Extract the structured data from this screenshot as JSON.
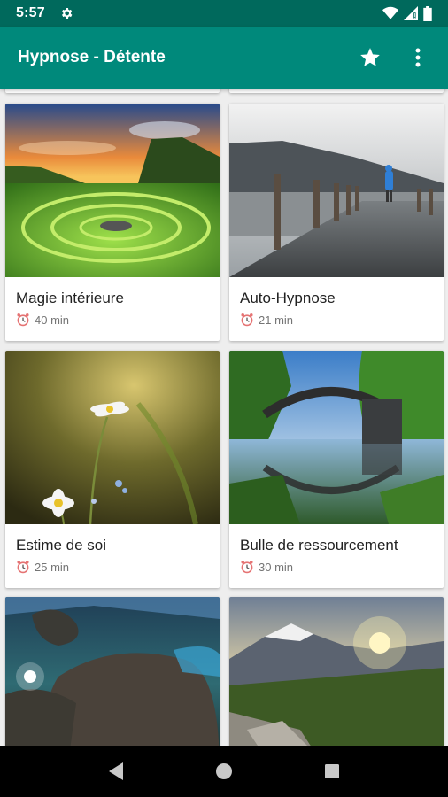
{
  "status_bar": {
    "time": "5:57",
    "icons": [
      "gear-icon",
      "wifi-icon",
      "signal-icon",
      "battery-icon"
    ]
  },
  "app_bar": {
    "title": "Hypnose - Détente",
    "actions": [
      "star-icon",
      "more-vert-icon"
    ]
  },
  "colors": {
    "status_bar": "#00695c",
    "app_bar": "#00897b",
    "background": "#eeeeee"
  },
  "cards": [
    {
      "title": "Magie intérieure",
      "duration": "40 min",
      "image": "fairy-circle-landscape"
    },
    {
      "title": "Auto-Hypnose",
      "duration": "21 min",
      "image": "misty-lake-jetty"
    },
    {
      "title": "Estime de soi",
      "duration": "25 min",
      "image": "daisy-flowers"
    },
    {
      "title": "Bulle de ressourcement",
      "duration": "30 min",
      "image": "stone-arch-bridge"
    },
    {
      "title": "",
      "duration": "",
      "image": "underwater-rocks"
    },
    {
      "title": "",
      "duration": "",
      "image": "mountain-sunrise"
    }
  ],
  "nav_bar": {
    "buttons": [
      "back-icon",
      "home-icon",
      "recents-icon"
    ]
  }
}
